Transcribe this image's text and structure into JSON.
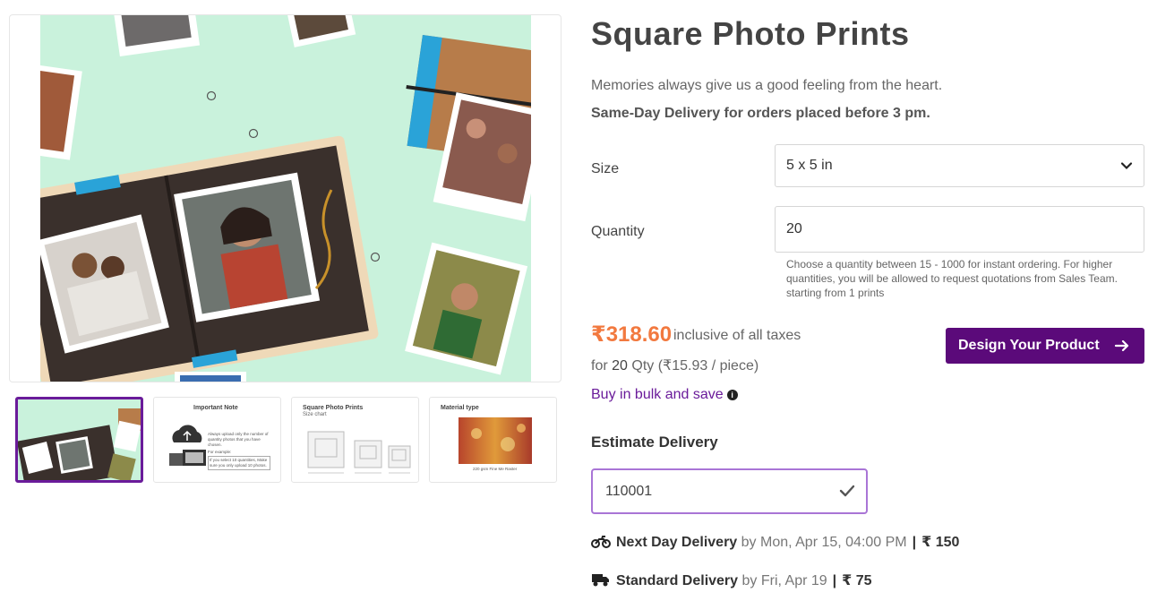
{
  "gallery": {
    "main_image_alt": "photo album with square prints on mint background",
    "thumbnails": [
      {
        "kind": "photo",
        "active": true
      },
      {
        "kind": "note",
        "title": "Important Note",
        "text": "Always upload only the number of quantity photos that you have chosen.",
        "example_label": "For example:",
        "example_text": "If you select 10 quantities, Make sure you only upload 10 photos."
      },
      {
        "kind": "size-chart",
        "title": "Square Photo Prints",
        "subtitle": "Size chart"
      },
      {
        "kind": "material",
        "title": "Material type",
        "caption": "220 gsm Fine Me Raster"
      }
    ]
  },
  "product": {
    "title": "Square Photo Prints",
    "tagline": "Memories always give us a good feeling from the heart.",
    "sameday_note": "Same-Day Delivery for orders placed before 3 pm.",
    "size": {
      "label": "Size",
      "selected": "5 x 5 in"
    },
    "quantity": {
      "label": "Quantity",
      "value": "20",
      "help": "Choose a quantity between 15 - 1000 for instant ordering. For higher quantities, you will be allowed to request quotations from Sales Team. starting from 1 prints"
    },
    "price": {
      "amount": "₹318.60",
      "note": "inclusive of all taxes",
      "per_prefix": "for ",
      "qty": "20",
      "qty_suffix": " Qty",
      "unit_price": "(₹15.93 / piece)"
    },
    "bulk_link": "Buy in bulk and save",
    "design_button": "Design Your Product"
  },
  "delivery": {
    "title": "Estimate Delivery",
    "pincode": "110001",
    "options": [
      {
        "icon": "motorbike-icon",
        "name": "Next Day Delivery",
        "when": "by Mon, Apr 15, 04:00 PM",
        "cost": "₹ 150"
      },
      {
        "icon": "truck-icon",
        "name": "Standard Delivery",
        "when": "by Fri, Apr 19",
        "cost": "₹ 75"
      }
    ]
  },
  "colors": {
    "accent": "#5b0a7a",
    "price": "#f2793f",
    "link": "#6a1b9a",
    "mint": "#c9f2dc"
  }
}
